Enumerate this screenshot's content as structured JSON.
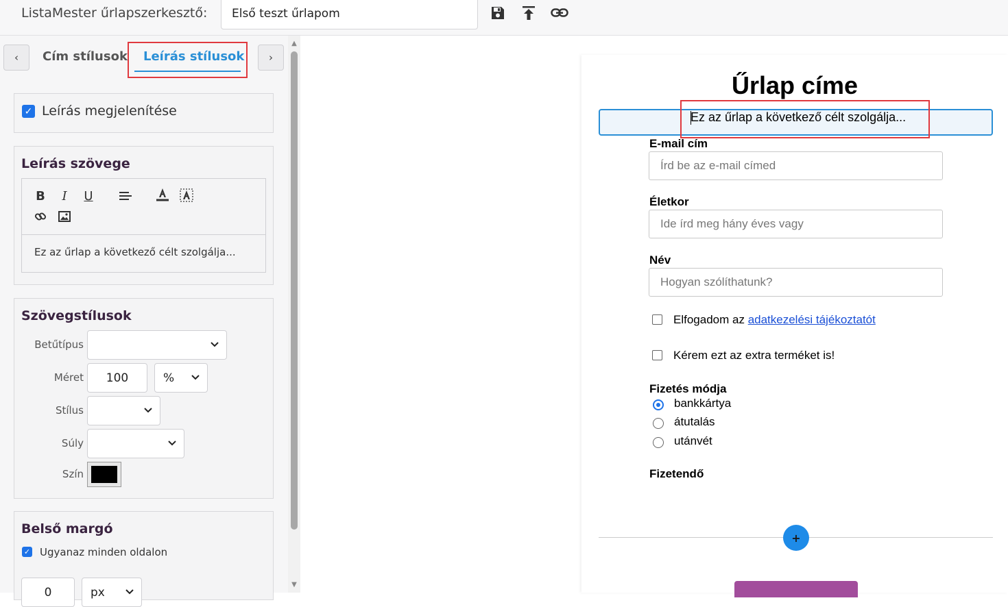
{
  "topbar": {
    "app_title": "ListaMester űrlapszerkesztő:",
    "form_name": "Első teszt űrlapom",
    "icons": [
      "save-icon",
      "publish-icon",
      "link-icon"
    ]
  },
  "tabs": {
    "prev_label": "‹",
    "next_label": "›",
    "items": [
      {
        "label": "Cím stílusok"
      },
      {
        "label": "Leírás stílusok"
      }
    ],
    "active_index": 1
  },
  "description_panel": {
    "show_checkbox_label": "Leírás megjelenítése",
    "show_checked": true,
    "text_heading": "Leírás szövege",
    "editor_buttons": [
      "bold",
      "italic",
      "underline",
      "align",
      "font-color",
      "background-color",
      "link",
      "image"
    ],
    "editor_text": "Ez az űrlap a következő célt szolgálja..."
  },
  "text_styles": {
    "heading": "Szövegstílusok",
    "font_label": "Betűtípus",
    "font_value": "",
    "size_label": "Méret",
    "size_value": "100",
    "size_unit": "%",
    "style_label": "Stílus",
    "style_value": "",
    "weight_label": "Súly",
    "weight_value": "",
    "color_label": "Szín",
    "color_value": "#000000"
  },
  "padding": {
    "heading": "Belső margó",
    "same_all_sides_label": "Ugyanaz minden oldalon",
    "same_all_sides_checked": true,
    "value": "0",
    "unit": "px"
  },
  "preview": {
    "form_title": "Űrlap címe",
    "description": "Ez az űrlap a következő célt szolgálja...",
    "fields": [
      {
        "label": "E-mail cím",
        "placeholder": "Írd be az e-mail címed"
      },
      {
        "label": "Életkor",
        "placeholder": "Ide írd meg hány éves vagy"
      },
      {
        "label": "Név",
        "placeholder": "Hogyan szólíthatunk?"
      }
    ],
    "consent_prefix": "Elfogadom az ",
    "consent_link": "adatkezelési tájékoztatót",
    "extra_product_label": "Kérem ezt az extra terméket is!",
    "payment_label": "Fizetés módja",
    "payment_options": [
      "bankkártya",
      "átutalás",
      "utánvét"
    ],
    "payment_selected": 0,
    "amount_label": "Fizetendő",
    "add_button_label": "+"
  },
  "colors": {
    "accent": "#2a8fd6",
    "highlight": "#e0393e",
    "submit": "#a24d9c",
    "checkbox": "#1e73e8"
  }
}
